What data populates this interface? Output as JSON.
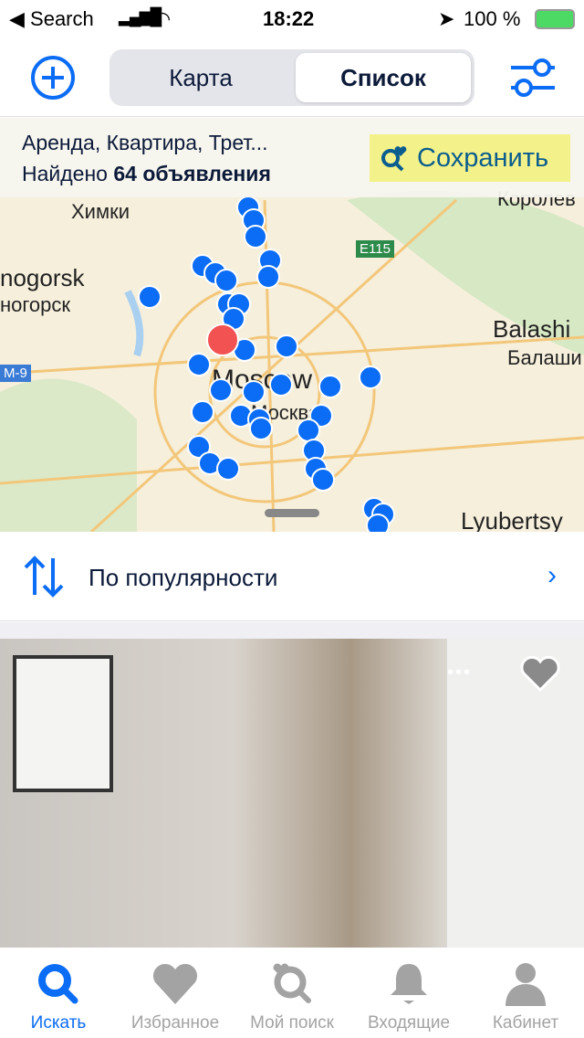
{
  "status": {
    "back": "Search",
    "time": "18:22",
    "battery": "100 %"
  },
  "nav": {
    "segments": [
      "Карта",
      "Список"
    ],
    "active": 1
  },
  "filter": {
    "summary": "Аренда, Квартира, Трет...",
    "found_prefix": "Найдено",
    "found_count": "64 объявления",
    "save_label": "Сохранить"
  },
  "map": {
    "labels": [
      "Химки",
      "nogorsk",
      "ногорск",
      "Balashi",
      "Балаши",
      "Королев",
      "E115",
      "M-9",
      "Moscow",
      "Москва",
      "Lyubertsy"
    ]
  },
  "sort": {
    "label": "По популярности"
  },
  "tabs": [
    {
      "label": "Искать",
      "icon": "search-icon",
      "active": true
    },
    {
      "label": "Избранное",
      "icon": "heart-icon"
    },
    {
      "label": "Мой поиск",
      "icon": "saved-search-icon"
    },
    {
      "label": "Входящие",
      "icon": "bell-icon"
    },
    {
      "label": "Кабинет",
      "icon": "user-icon"
    }
  ],
  "colors": {
    "accent": "#0b6cf5",
    "save_bg": "#f3f28a",
    "selected_pin": "#f25252"
  }
}
